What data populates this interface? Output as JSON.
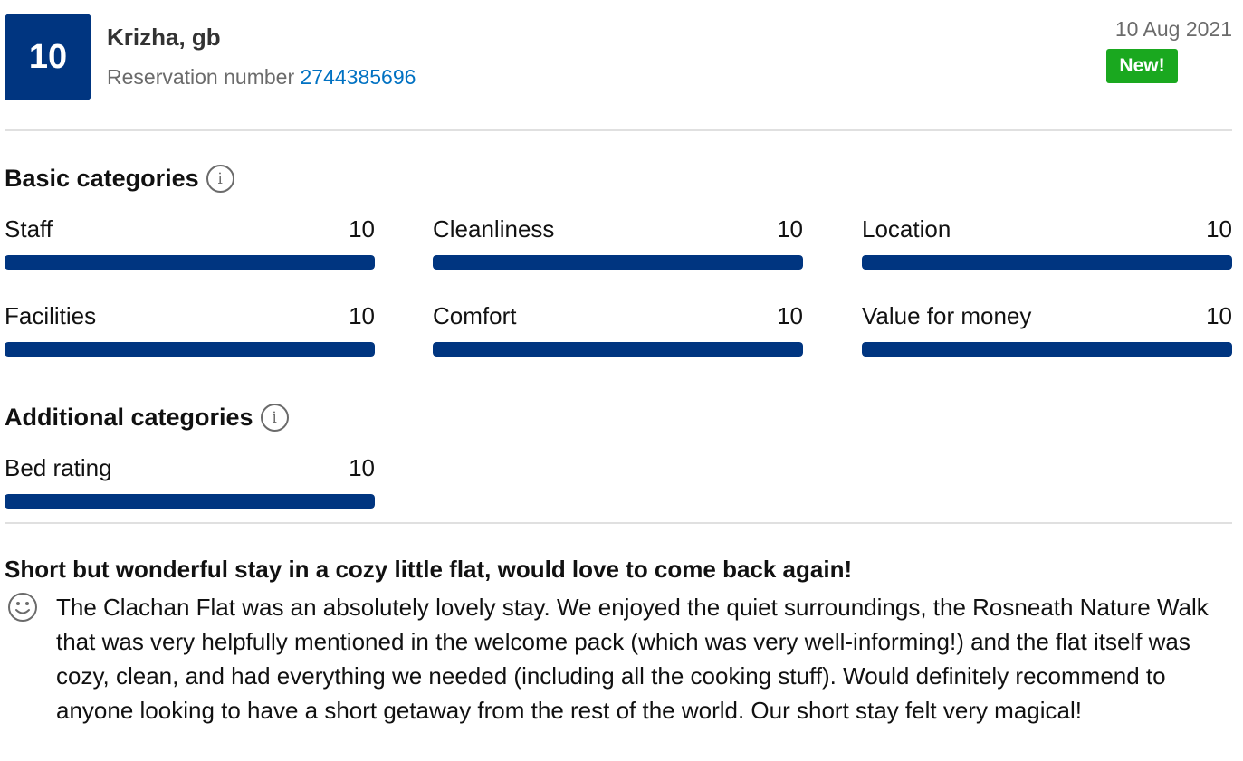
{
  "header": {
    "score": "10",
    "guest_name": "Krizha, gb",
    "reservation_label": "Reservation number",
    "reservation_number": "2744385696",
    "date": "10 Aug 2021",
    "new_badge": "New!"
  },
  "basic": {
    "title": "Basic categories",
    "items": [
      {
        "label": "Staff",
        "score": "10",
        "fraction": 1.0
      },
      {
        "label": "Cleanliness",
        "score": "10",
        "fraction": 1.0
      },
      {
        "label": "Location",
        "score": "10",
        "fraction": 1.0
      },
      {
        "label": "Facilities",
        "score": "10",
        "fraction": 1.0
      },
      {
        "label": "Comfort",
        "score": "10",
        "fraction": 1.0
      },
      {
        "label": "Value for money",
        "score": "10",
        "fraction": 1.0
      }
    ]
  },
  "additional": {
    "title": "Additional categories",
    "items": [
      {
        "label": "Bed rating",
        "score": "10",
        "fraction": 1.0
      }
    ]
  },
  "review": {
    "title": "Short but wonderful stay in a cozy little flat, would love to come back again!",
    "sentiment_icon": "smile-icon",
    "body": "The Clachan Flat was an absolutely lovely stay. We enjoyed the quiet surroundings, the Rosneath Nature Walk that was very helpfully mentioned in the welcome pack (which was very well-informing!) and the flat itself was cozy, clean, and had everything we needed (including all the cooking stuff). Would definitely recommend to anyone looking to have a short getaway from the rest of the world. Our short stay felt very magical!"
  },
  "colors": {
    "brand": "#003580",
    "link": "#0071c2",
    "new_badge": "#1aa81f"
  }
}
